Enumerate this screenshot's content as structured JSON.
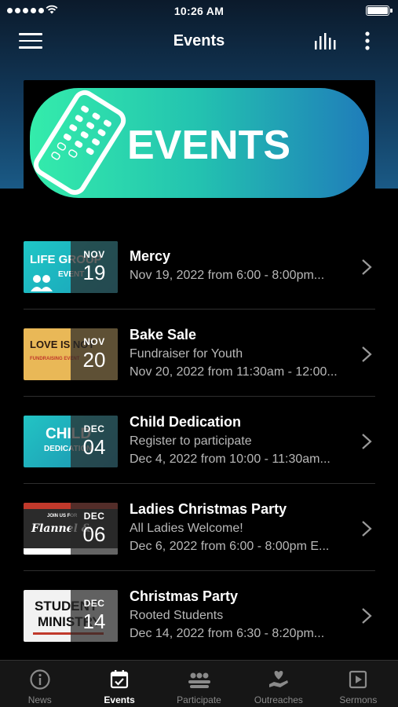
{
  "status_bar": {
    "time": "10:26 AM"
  },
  "nav": {
    "title": "Events"
  },
  "banner": {
    "text": "EVENTS"
  },
  "events": [
    {
      "title": "Mercy",
      "lines": [
        "Nov 19, 2022 from 6:00 - 8:00pm..."
      ],
      "month": "NOV",
      "day": "19",
      "thumb_text": "LIFE GROUP",
      "thumb_sub": "EVENT"
    },
    {
      "title": "Bake Sale",
      "lines": [
        "Fundraiser for Youth",
        "Nov 20, 2022 from 11:30am - 12:00..."
      ],
      "month": "NOV",
      "day": "20",
      "thumb_text": "LOVE IS NOT",
      "thumb_sub": "FUNDRAISING EVENT"
    },
    {
      "title": "Child Dedication",
      "lines": [
        "Register to participate",
        "Dec 4, 2022 from 10:00 - 11:30am..."
      ],
      "month": "DEC",
      "day": "04",
      "thumb_text": "CHILD",
      "thumb_sub": "DEDICATION"
    },
    {
      "title": "Ladies Christmas Party",
      "lines": [
        "All Ladies Welcome!",
        "Dec 6, 2022 from 6:00 - 8:00pm E..."
      ],
      "month": "DEC",
      "day": "06",
      "thumb_text": "Flannel &",
      "thumb_sub": "JOIN US FOR"
    },
    {
      "title": "Christmas Party",
      "lines": [
        "Rooted Students",
        "Dec 14, 2022 from 6:30 - 8:20pm..."
      ],
      "month": "DEC",
      "day": "14",
      "thumb_text": "STUDENT",
      "thumb_sub": "MINISTRY"
    }
  ],
  "tabs": [
    {
      "label": "News",
      "icon": "info-icon"
    },
    {
      "label": "Events",
      "icon": "calendar-icon",
      "active": true
    },
    {
      "label": "Participate",
      "icon": "people-icon"
    },
    {
      "label": "Outreaches",
      "icon": "hand-heart-icon"
    },
    {
      "label": "Sermons",
      "icon": "play-icon"
    }
  ],
  "colors": {
    "header_top": "#0b1a2b",
    "header_bottom": "#1a5a86",
    "banner_green": "#2fe3a6",
    "banner_blue": "#1e7fb8",
    "background": "#000000"
  }
}
